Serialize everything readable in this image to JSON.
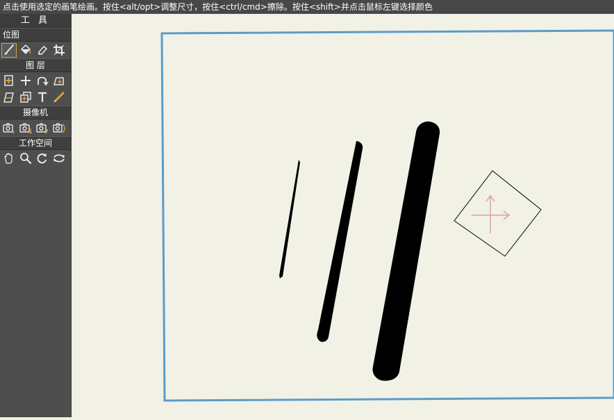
{
  "status_text": "点击使用选定的画笔绘画。按住<alt/opt>调整尺寸，按住<ctrl/cmd>擦除。按住<shift>并点击鼠标左键选择颜色",
  "toolbox": {
    "title": "工 具",
    "sections": [
      {
        "label": "位图",
        "tools": [
          "brush-icon",
          "fill-bucket-icon",
          "eraser-icon",
          "crop-icon"
        ]
      },
      {
        "label": "图  层",
        "tools": [
          "new-layer-icon",
          "add-icon",
          "curve-arrow-icon",
          "layer-move-icon",
          "layer-transform-icon",
          "duplicate-layer-icon",
          "text-icon",
          "eyedropper-icon"
        ]
      },
      {
        "label": "摄像机",
        "tools": [
          "camera-add-icon",
          "camera-move-icon",
          "camera-edit-icon",
          "camera-rotate-icon"
        ]
      },
      {
        "label": "工作空间",
        "tools": [
          "hand-icon",
          "zoom-icon",
          "rotate-icon",
          "reset-rotate-icon"
        ]
      }
    ]
  },
  "colors": {
    "accent": "#d9a13a",
    "frame_border": "#5b9bc8",
    "canvas_bg": "#f2f1e6",
    "stroke": "#000000"
  }
}
